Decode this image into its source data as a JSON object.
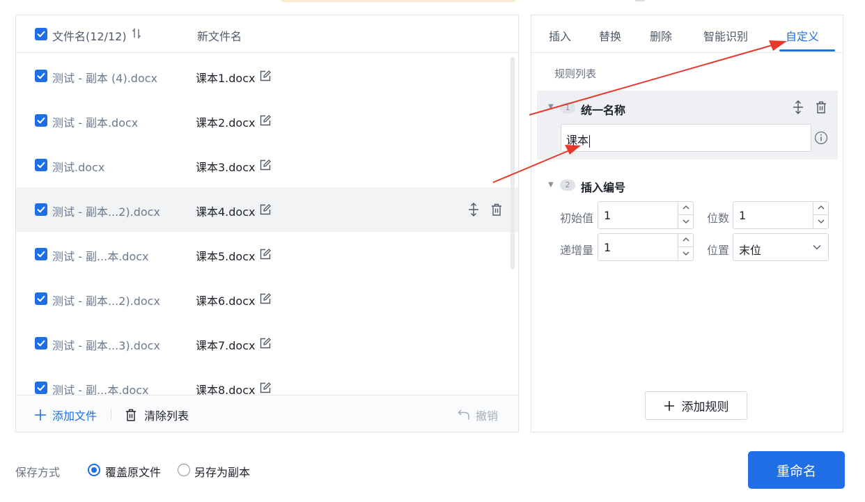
{
  "file_list": {
    "header": {
      "original_label": "文件名(12/12)",
      "new_label": "新文件名"
    },
    "rows": [
      {
        "original": "测试 - 副本 (4).docx",
        "new": "课本1.docx"
      },
      {
        "original": "测试 - 副本.docx",
        "new": "课本2.docx"
      },
      {
        "original": "测试.docx",
        "new": "课本3.docx"
      },
      {
        "original": "测试 - 副本...2).docx",
        "new": "课本4.docx"
      },
      {
        "original": "测试 - 副...本.docx",
        "new": "课本5.docx"
      },
      {
        "original": "测试 - 副本...2).docx",
        "new": "课本6.docx"
      },
      {
        "original": "测试 - 副本...3).docx",
        "new": "课本7.docx"
      },
      {
        "original": "测试 - 副...本.docx",
        "new": "课本8.docx"
      }
    ],
    "footer": {
      "add_file": "添加文件",
      "clear_list": "清除列表",
      "undo": "撤销"
    }
  },
  "rules_panel": {
    "tabs": [
      "插入",
      "替换",
      "删除",
      "智能识别",
      "自定义"
    ],
    "active_tab": "自定义",
    "rules_title": "规则列表",
    "rule1": {
      "index": "1",
      "name": "统一名称",
      "value": "课本"
    },
    "rule2": {
      "index": "2",
      "name": "插入编号",
      "start_label": "初始值",
      "start_value": "1",
      "digits_label": "位数",
      "digits_value": "1",
      "step_label": "递增量",
      "step_value": "1",
      "position_label": "位置",
      "position_value": "末位"
    },
    "add_rule": "添加规则"
  },
  "bottom": {
    "save_mode_label": "保存方式",
    "option_overwrite": "覆盖原文件",
    "option_copy": "另存为副本",
    "rename_button": "重命名"
  },
  "colors": {
    "accent": "#1f6ee6",
    "arrow": "#e8382b"
  }
}
